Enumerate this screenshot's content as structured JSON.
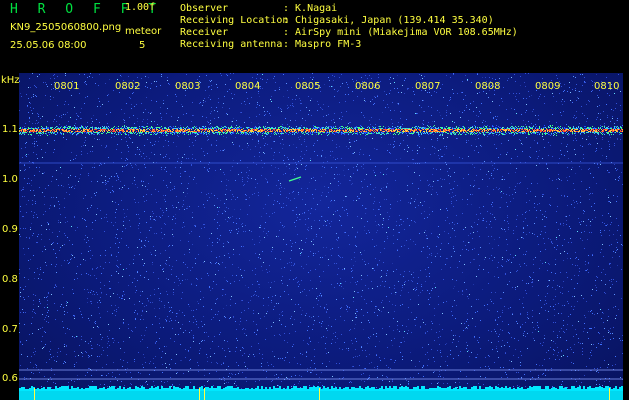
{
  "app_title": "H R O F F T",
  "version": "1.00f",
  "filename": "KN9_2505060800.png",
  "datetime": "25.05.06 08:00",
  "meteor_label": "meteor",
  "meteor_count": "5",
  "info": [
    {
      "label": "Observer",
      "value": ": K.Nagai"
    },
    {
      "label": "Receiving Location",
      "value": ": Chigasaki, Japan (139.414 35.340)"
    },
    {
      "label": "Receiver",
      "value": ": AirSpy mini (Miakejima VOR 108.65MHz)"
    },
    {
      "label": "Receiving antenna",
      "value": ": Maspro FM-3"
    }
  ],
  "y_unit": "kHz",
  "y_ticks": [
    "1.1",
    "1.0",
    "0.9",
    "0.8",
    "0.7",
    "0.6"
  ],
  "x_ticks": [
    "0801",
    "0802",
    "0803",
    "0804",
    "0805",
    "0806",
    "0807",
    "0808",
    "0809",
    "0810"
  ],
  "colors": {
    "text": "#ffff40",
    "title": "#00e040",
    "background": "#0b1a7a",
    "signal": "#ff4040",
    "noise_floor": "#00e8ff"
  }
}
